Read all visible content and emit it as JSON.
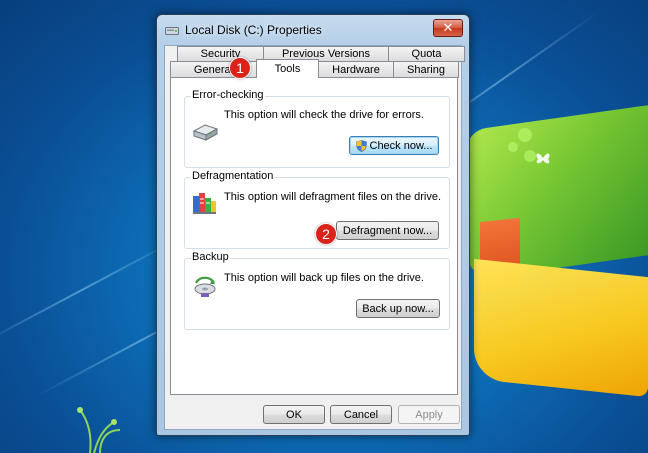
{
  "window": {
    "title": "Local Disk (C:) Properties",
    "close_label": "✕"
  },
  "tabs": {
    "row1": [
      "Security",
      "Previous Versions",
      "Quota"
    ],
    "row2": [
      "General",
      "Tools",
      "Hardware",
      "Sharing"
    ],
    "active": "Tools"
  },
  "groups": {
    "error_checking": {
      "label": "Error-checking",
      "description": "This option will check the drive for errors.",
      "button": "Check now..."
    },
    "defragmentation": {
      "label": "Defragmentation",
      "description": "This option will defragment files on the drive.",
      "button": "Defragment now..."
    },
    "backup": {
      "label": "Backup",
      "description": "This option will back up files on the drive.",
      "button": "Back up now..."
    }
  },
  "footer": {
    "ok": "OK",
    "cancel": "Cancel",
    "apply": "Apply"
  },
  "markers": [
    "1",
    "2"
  ],
  "colors": {
    "marker": "#d9231b",
    "desktop": "#0d6fb8",
    "close_button": "#c7381c"
  },
  "icons": {
    "title": "drive-icon",
    "error_checking": "hard-drive-icon",
    "defragmentation": "defrag-icon",
    "backup": "backup-icon",
    "check_button": "uac-shield-icon"
  }
}
